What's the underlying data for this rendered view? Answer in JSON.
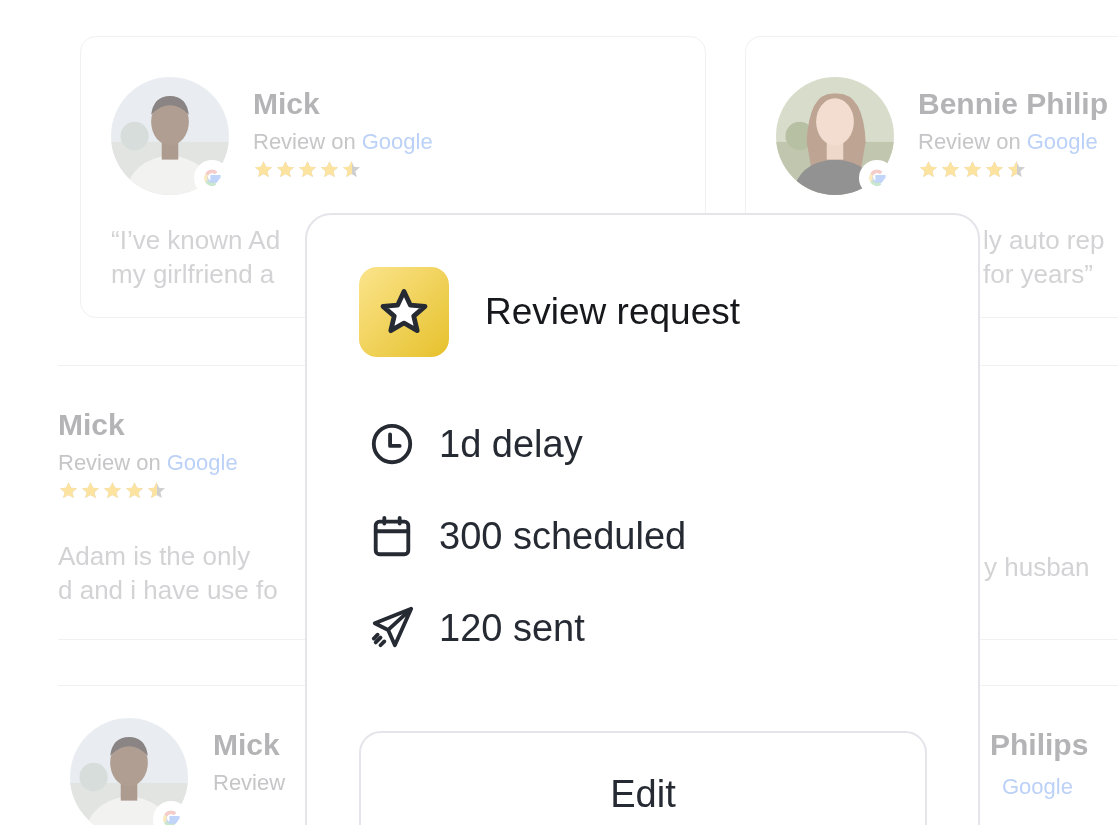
{
  "background_reviews": [
    {
      "avatar": {
        "kind": "picture"
      },
      "name": "Mick",
      "source_prefix": "Review on",
      "source": "Google",
      "stars": 4.5,
      "quote": [
        "“I’ve known Ad",
        "my girlfriend a"
      ]
    },
    {
      "avatar": {
        "kind": "picture"
      },
      "name": "Bennie Philip",
      "source_prefix": "Review on",
      "source": "Google",
      "stars": 4.5,
      "quote": [
        "ly auto rep",
        "for years”"
      ]
    },
    {
      "name": "Mick",
      "source_prefix": "Review on",
      "source": "Google",
      "stars": 4.5,
      "quote": [
        "Adam is the only",
        "d and i have use fo"
      ]
    },
    {
      "quote": [
        "y husban"
      ]
    },
    {
      "avatar": {
        "kind": "picture"
      },
      "name": "Mick",
      "source_prefix": "Review"
    },
    {
      "name": "Philips",
      "source": "Google"
    }
  ],
  "review_request": {
    "title": "Review request",
    "stats": [
      {
        "kind": "delay",
        "text": "1d delay"
      },
      {
        "kind": "scheduled",
        "text": "300 scheduled"
      },
      {
        "kind": "sent",
        "text": "120 sent"
      }
    ],
    "button": "Edit"
  }
}
